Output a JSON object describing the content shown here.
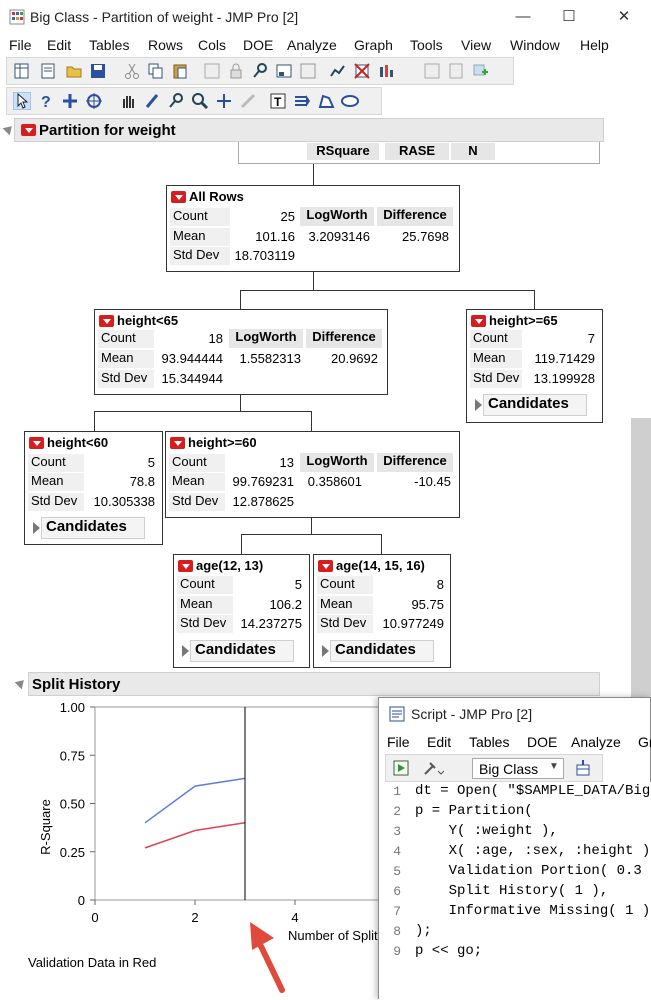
{
  "window": {
    "title": "Big Class - Partition of weight - JMP Pro [2]"
  },
  "menus": [
    "File",
    "Edit",
    "Tables",
    "Rows",
    "Cols",
    "DOE",
    "Analyze",
    "Graph",
    "Tools",
    "View",
    "Window",
    "Help"
  ],
  "report": {
    "outline_title": "Partition for weight",
    "summary_headers": [
      "RSquare",
      "RASE",
      "N"
    ],
    "nodes": {
      "all": {
        "title": "All Rows",
        "count": "25",
        "mean": "101.16",
        "std": "18.703119",
        "logworth": "3.2093146",
        "difference": "25.7698"
      },
      "h_lt65": {
        "title": "height<65",
        "count": "18",
        "mean": "93.944444",
        "std": "15.344944",
        "logworth": "1.5582313",
        "difference": "20.9692"
      },
      "h_ge65": {
        "title": "height>=65",
        "count": "7",
        "mean": "119.71429",
        "std": "13.199928"
      },
      "h_lt60": {
        "title": "height<60",
        "count": "5",
        "mean": "78.8",
        "std": "10.305338"
      },
      "h_ge60": {
        "title": "height>=60",
        "count": "13",
        "mean": "99.769231",
        "std": "12.878625",
        "logworth": "0.358601",
        "difference": "-10.45"
      },
      "age1213": {
        "title": "age(12, 13)",
        "count": "5",
        "mean": "106.2",
        "std": "14.237275"
      },
      "age141516": {
        "title": "age(14, 15, 16)",
        "count": "8",
        "mean": "95.75",
        "std": "10.977249"
      }
    },
    "labels": {
      "count": "Count",
      "mean": "Mean",
      "std": "Std Dev",
      "logworth": "LogWorth",
      "difference": "Difference",
      "candidates": "Candidates"
    }
  },
  "split_history": {
    "title": "Split History",
    "footnote": "Validation Data in Red",
    "chart_data": {
      "type": "line",
      "ylabel": "R-Square",
      "xlabel": "Number of Splits",
      "ylim": [
        0,
        1
      ],
      "xlim": [
        0,
        5.8
      ],
      "yticks": [
        "1.00",
        "0.75",
        "0.50",
        "0.25",
        "0"
      ],
      "xticks": [
        "0",
        "2",
        "4"
      ],
      "cursor_x": 3,
      "series": [
        {
          "color": "#5b7fe0",
          "x": [
            1,
            2,
            3
          ],
          "y": [
            0.4,
            0.59,
            0.63
          ]
        },
        {
          "color": "#e0405a",
          "x": [
            1,
            2,
            3
          ],
          "y": [
            0.27,
            0.36,
            0.4
          ]
        }
      ]
    }
  },
  "script_window": {
    "title": "Script - JMP Pro [2]",
    "menus": [
      "File",
      "Edit",
      "Tables",
      "DOE",
      "Analyze",
      "Gr"
    ],
    "table_select": "Big Class",
    "line_numbers": [
      "1",
      "2",
      "3",
      "4",
      "5",
      "6",
      "7",
      "8",
      "9"
    ],
    "lines": [
      "dt = Open( \"$SAMPLE_DATA/Big",
      "p = Partition(",
      "    Y( :weight ),",
      "    X( :age, :sex, :height )",
      "    Validation Portion( 0.3",
      "    Split History( 1 ),",
      "    Informative Missing( 1 )",
      ");",
      "p << go;"
    ]
  }
}
